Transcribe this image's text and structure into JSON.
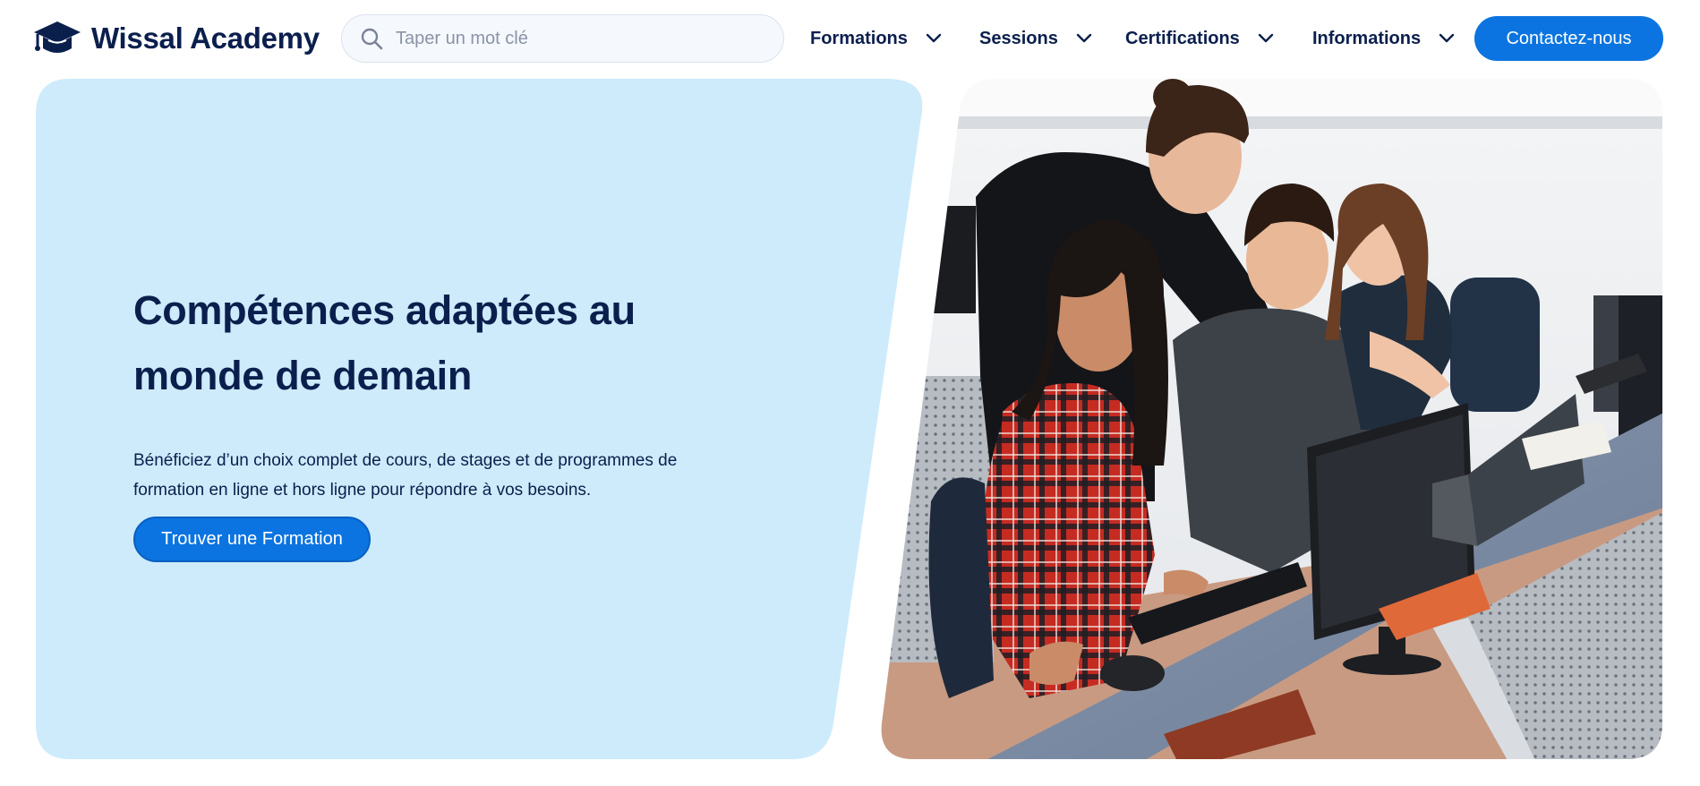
{
  "brand": {
    "name": "Wissal Academy",
    "logo_icon": "graduation-cap-icon",
    "color": "#0b1f4d"
  },
  "search": {
    "placeholder": "Taper un mot clé",
    "value": "",
    "icon": "search-icon"
  },
  "nav": {
    "items": [
      {
        "label": "Formations",
        "icon": "chevron-down-icon"
      },
      {
        "label": "Sessions",
        "icon": "chevron-down-icon"
      },
      {
        "label": "Certifications",
        "icon": "chevron-down-icon"
      },
      {
        "label": "Informations",
        "icon": "chevron-down-icon"
      }
    ],
    "cta_label": "Contactez-nous"
  },
  "hero": {
    "title_line1": "Compétences adaptées au",
    "title_line2": "monde de demain",
    "description_line1": "Bénéficiez d’un choix complet de cours, de stages et de programmes de",
    "description_line2": "formation en ligne et hors ligne pour répondre à vos besoins.",
    "button_label": "Trouver une Formation",
    "panel_color": "#cdebfb",
    "photo": "students-at-computers-photo"
  },
  "colors": {
    "accent": "#0b74e0",
    "text": "#0b1f4d",
    "panel": "#cdebfb"
  }
}
